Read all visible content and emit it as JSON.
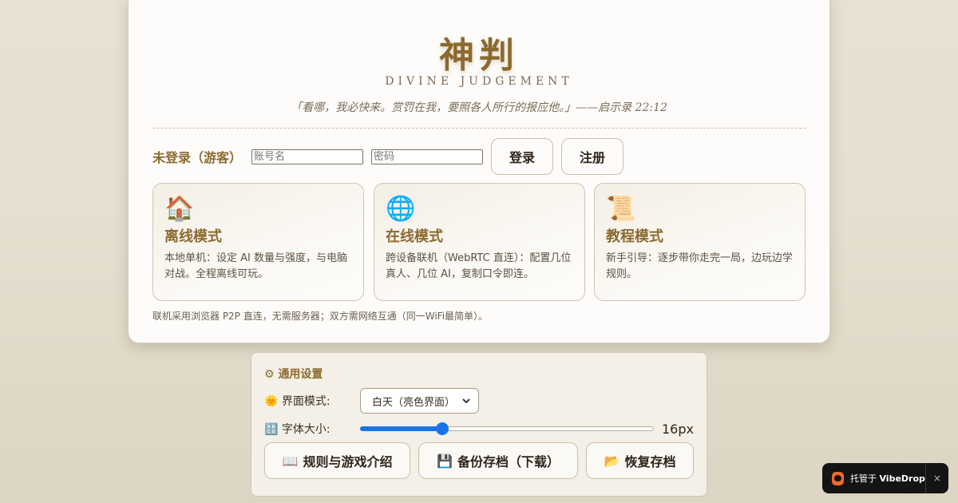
{
  "header": {
    "title": "神判",
    "subtitle": "DIVINE JUDGEMENT",
    "quote": "「看哪，我必快来。赏罚在我，要照各人所行的报应他。」——启示录 22:12"
  },
  "login": {
    "status": "未登录（游客）",
    "username_placeholder": "账号名",
    "password_placeholder": "密码",
    "login_label": "登录",
    "register_label": "注册"
  },
  "modes": [
    {
      "icon": "🏠",
      "icon_name": "house-icon",
      "title": "离线模式",
      "desc": "本地单机：设定 AI 数量与强度，与电脑对战。全程离线可玩。"
    },
    {
      "icon": "🌐",
      "icon_name": "globe-icon",
      "title": "在线模式",
      "desc": "跨设备联机（WebRTC 直连）：配置几位真人、几位 AI，复制口令即连。"
    },
    {
      "icon": "📜",
      "icon_name": "scroll-icon",
      "title": "教程模式",
      "desc": "新手引导：逐步带你走完一局，边玩边学规则。"
    }
  ],
  "footnote": "联机采用浏览器 P2P 直连，无需服务器；双方需网络互通（同一WiFi最简单）。",
  "settings": {
    "icon": "⚙",
    "title": "通用设置",
    "theme_icon": "🌞",
    "theme_label": "界面模式:",
    "theme_value": "白天（亮色界面）",
    "font_icon": "🔠",
    "font_label": "字体大小:",
    "font_size_value": "16px",
    "font_slider_fraction": 0.28,
    "rules_icon": "📖",
    "rules_label": "规则与游戏介绍",
    "backup_icon": "💾",
    "backup_label": "备份存档（下载）",
    "restore_icon": "📂",
    "restore_label": "恢复存档"
  },
  "badge": {
    "prefix": "托管于",
    "brand": "VibeDrop",
    "close": "×"
  },
  "colors": {
    "accent": "#8b6a2f",
    "slider": "#1a73e8",
    "badge_logo": "#f06a2a"
  }
}
